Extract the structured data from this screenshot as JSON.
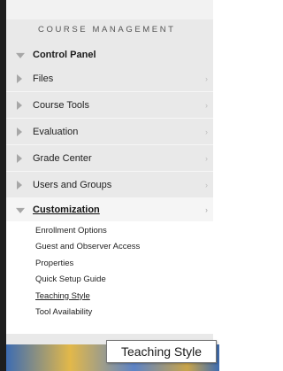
{
  "section_header": "COURSE MANAGEMENT",
  "control_panel": {
    "label": "Control Panel",
    "icon": "triangle-down-icon"
  },
  "menu_items": [
    {
      "label": "Files",
      "chevron": "›"
    },
    {
      "label": "Course Tools",
      "chevron": "›"
    },
    {
      "label": "Evaluation",
      "chevron": "›"
    },
    {
      "label": "Grade Center",
      "chevron": "›"
    },
    {
      "label": "Users and Groups",
      "chevron": "›"
    }
  ],
  "customization": {
    "label": "Customization",
    "chevron": "›",
    "items": [
      {
        "label": "Enrollment Options"
      },
      {
        "label": "Guest and Observer Access"
      },
      {
        "label": "Properties"
      },
      {
        "label": "Quick Setup Guide"
      },
      {
        "label": "Teaching Style"
      },
      {
        "label": "Tool Availability"
      }
    ]
  },
  "tooltip": "Teaching Style",
  "colors": {
    "panel_background": "#e9e9e9",
    "triangle": "#a7a7a7",
    "left_strip": "#1e1e1e"
  }
}
